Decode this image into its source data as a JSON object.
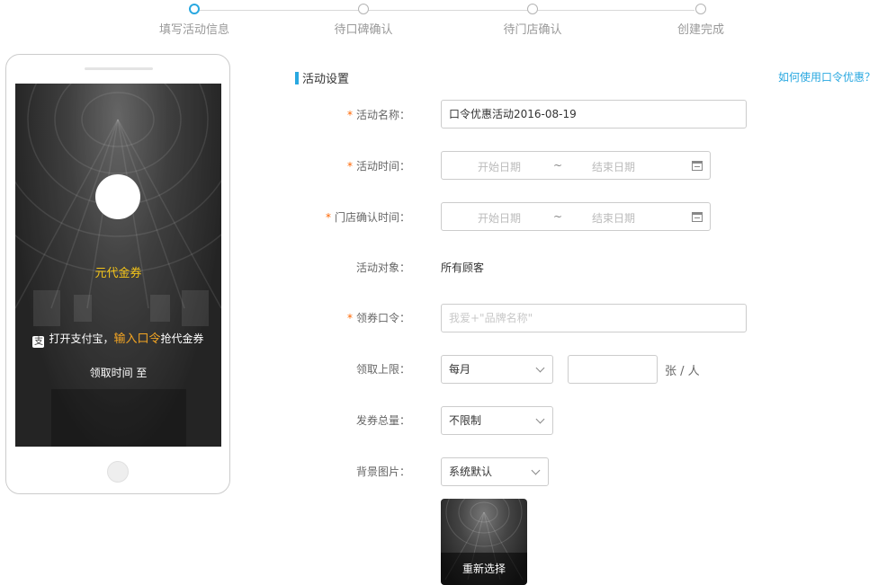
{
  "steps": [
    {
      "label": "填写活动信息",
      "active": true
    },
    {
      "label": "待口碑确认",
      "active": false
    },
    {
      "label": "待门店确认",
      "active": false
    },
    {
      "label": "创建完成",
      "active": false
    }
  ],
  "preview": {
    "coupon_name": "元代金券",
    "promo_prefix": "打开支付宝，",
    "promo_highlight": "输入口令",
    "promo_suffix": "抢代金券",
    "alipay_icon": "支",
    "time_text": "领取时间 至"
  },
  "form": {
    "section_title": "活动设置",
    "help_link": "如何使用口令优惠？",
    "required_mark": "*",
    "activity_name": {
      "label": "活动名称：",
      "value": "口令优惠活动2016-08-19"
    },
    "activity_time": {
      "label": "活动时间：",
      "start_placeholder": "开始日期",
      "separator": "~",
      "end_placeholder": "结束日期"
    },
    "store_confirm_time": {
      "label": "门店确认时间：",
      "start_placeholder": "开始日期",
      "separator": "~",
      "end_placeholder": "结束日期"
    },
    "activity_target": {
      "label": "活动对象：",
      "value": "所有顾客"
    },
    "coupon_code": {
      "label": "领券口令：",
      "placeholder": "我爱+\"品牌名称\""
    },
    "receive_limit": {
      "label": "领取上限：",
      "period": "每月",
      "count": "",
      "unit": "张 / 人"
    },
    "total_issue": {
      "label": "发券总量：",
      "value": "不限制"
    },
    "background_image": {
      "label": "背景图片：",
      "value": "系统默认",
      "reselect": "重新选择"
    }
  },
  "colors": {
    "accent": "#29a8e0",
    "required": "#ff6600",
    "coupon_gold": "#f5c518",
    "highlight": "#f5a623"
  }
}
